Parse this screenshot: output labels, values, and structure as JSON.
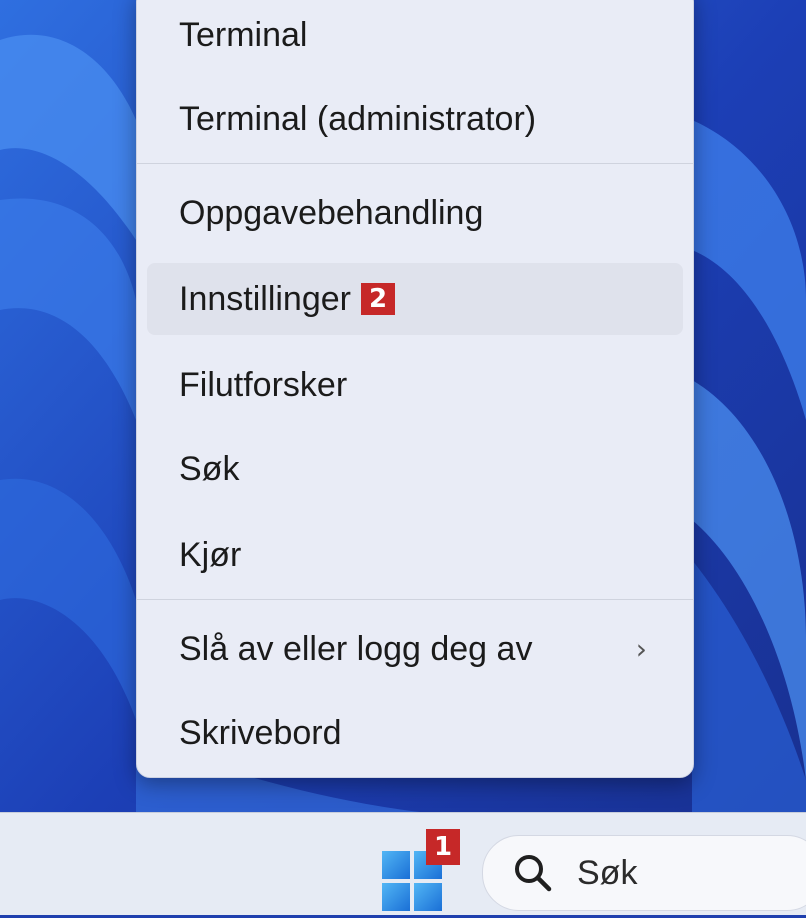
{
  "menu": {
    "items": [
      {
        "label": "Terminal"
      },
      {
        "label": "Terminal (administrator)"
      },
      {
        "label": "Oppgavebehandling"
      },
      {
        "label": "Innstillinger",
        "badge": "2"
      },
      {
        "label": "Filutforsker"
      },
      {
        "label": "Søk"
      },
      {
        "label": "Kjør"
      },
      {
        "label": "Slå av eller logg deg av",
        "submenu_icon": "chevron-right-icon"
      },
      {
        "label": "Skrivebord"
      }
    ]
  },
  "taskbar": {
    "start_badge": "1",
    "start_icon": "windows-logo-icon",
    "search_placeholder": "Søk",
    "search_icon": "search-icon"
  },
  "colors": {
    "badge": "#c62828",
    "wallpaper": "#1e3fae",
    "menu_bg": "#e9ecf6"
  }
}
